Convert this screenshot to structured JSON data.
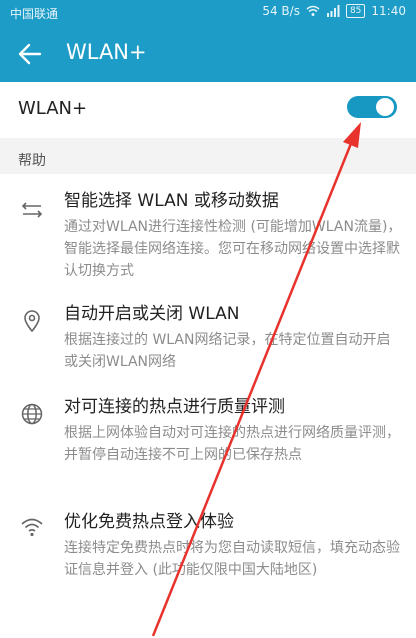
{
  "status_bar": {
    "carrier": "中国联通",
    "speed": "54 B/s",
    "battery": "85",
    "time": "11:40"
  },
  "header": {
    "back_icon": "back-arrow-icon",
    "title": "WLAN+"
  },
  "wlan_plus": {
    "label": "WLAN+",
    "enabled": true
  },
  "section": {
    "title": "帮助"
  },
  "help_items": [
    {
      "icon": "swap-arrows-icon",
      "title": "智能选择 WLAN 或移动数据",
      "description": "通过对WLAN进行连接性检测 (可能增加WLAN流量)，智能选择最佳网络连接。您可在移动网络设置中选择默认切换方式"
    },
    {
      "icon": "location-pin-icon",
      "title": "自动开启或关闭 WLAN",
      "description": "根据连接过的 WLAN网络记录，在特定位置自动开启或关闭WLAN网络"
    },
    {
      "icon": "globe-icon",
      "title": "对可连接的热点进行质量评测",
      "description": "根据上网体验自动对可连接的热点进行网络质量评测，并暂停自动连接不可上网的已保存热点"
    },
    {
      "icon": "wifi-icon",
      "title": "优化免费热点登入体验",
      "description": "连接特定免费热点时将为您自动读取短信，填充动态验证信息并登入 (此功能仅限中国大陆地区)"
    }
  ],
  "colors": {
    "header": "#1c9cc6",
    "toggle": "#1798c2",
    "annotation": "#e8322c"
  }
}
